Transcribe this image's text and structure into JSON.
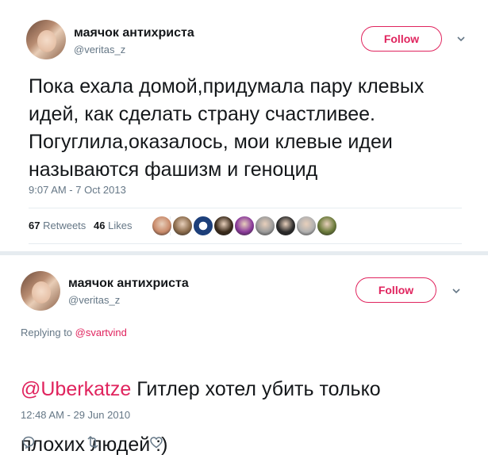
{
  "tweet1": {
    "display_name": "маячок антихриста",
    "handle": "@veritas_z",
    "follow_label": "Follow",
    "text": "Пока ехала домой,придумала пару клевых\nидей, как сделать страну счастливее.\nПогуглила,оказалось, мои клевые идеи\nназываются фашизм и геноцид",
    "timestamp": "9:07 AM - 7 Oct 2013",
    "retweets_count": "67",
    "retweets_label": "Retweets",
    "likes_count": "46",
    "likes_label": "Likes",
    "likers": [
      {
        "icon": "liker-avatar",
        "color": "#c98a6a"
      },
      {
        "icon": "liker-avatar",
        "color": "#8a6a4a"
      },
      {
        "icon": "cia-seal-icon",
        "color": "#1d3f7a"
      },
      {
        "icon": "liker-avatar",
        "color": "#3a2a1a"
      },
      {
        "icon": "liker-avatar",
        "color": "#8a3a9a"
      },
      {
        "icon": "liker-avatar",
        "color": "#9a9a9a"
      },
      {
        "icon": "liker-avatar",
        "color": "#2a2a2a"
      },
      {
        "icon": "liker-avatar",
        "color": "#b0b0b0"
      },
      {
        "icon": "liker-avatar",
        "color": "#6a7a3a"
      }
    ]
  },
  "tweet2": {
    "display_name": "маячок антихриста",
    "handle": "@veritas_z",
    "follow_label": "Follow",
    "replying_prefix": "Replying to",
    "replying_to": "@svartvind",
    "mention": "@Uberkatze",
    "text_line1": " Гитлер хотел убить только",
    "text_line2": "плохих людей :)",
    "timestamp": "12:48 AM - 29 Jun 2010"
  },
  "colors": {
    "accent": "#e0245e",
    "secondary_text": "#657786",
    "divider": "#e6ecf0"
  }
}
